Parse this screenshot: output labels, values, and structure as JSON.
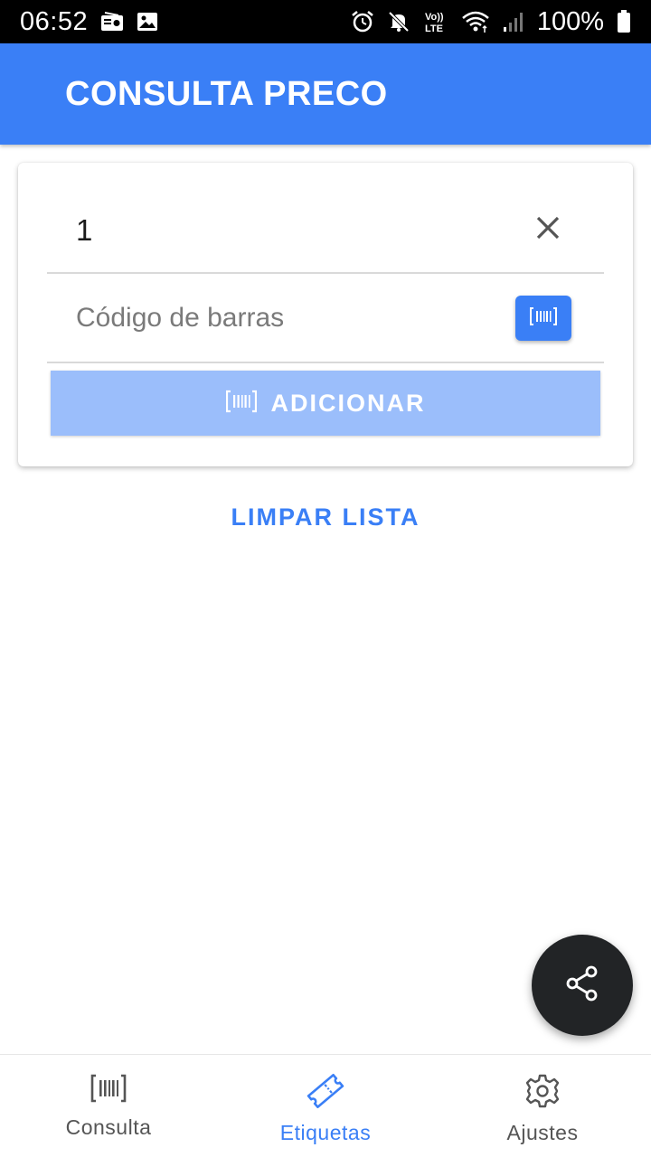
{
  "status_bar": {
    "time": "06:52",
    "battery_percent": "100%",
    "left_icons": [
      "radio-icon",
      "image-icon"
    ],
    "right_icons": [
      "alarm-icon",
      "mute-icon",
      "volte-icon",
      "wifi-icon",
      "signal-icon",
      "battery-icon"
    ]
  },
  "app_bar": {
    "title": "CONSULTA PRECO",
    "color": "#3a7ff6"
  },
  "form": {
    "quantity_value": "1",
    "clear_icon": "close-icon",
    "barcode_placeholder": "Código de barras",
    "barcode_value": "",
    "scan_icon": "barcode-icon",
    "add_label": "ADICIONAR",
    "add_icon": "barcode-icon"
  },
  "clear_list_label": "LIMPAR LISTA",
  "fab": {
    "icon": "share-icon"
  },
  "bottom_nav": {
    "items": [
      {
        "label": "Consulta",
        "icon": "barcode-icon",
        "active": false
      },
      {
        "label": "Etiquetas",
        "icon": "ticket-icon",
        "active": true
      },
      {
        "label": "Ajustes",
        "icon": "gear-icon",
        "active": false
      }
    ]
  }
}
